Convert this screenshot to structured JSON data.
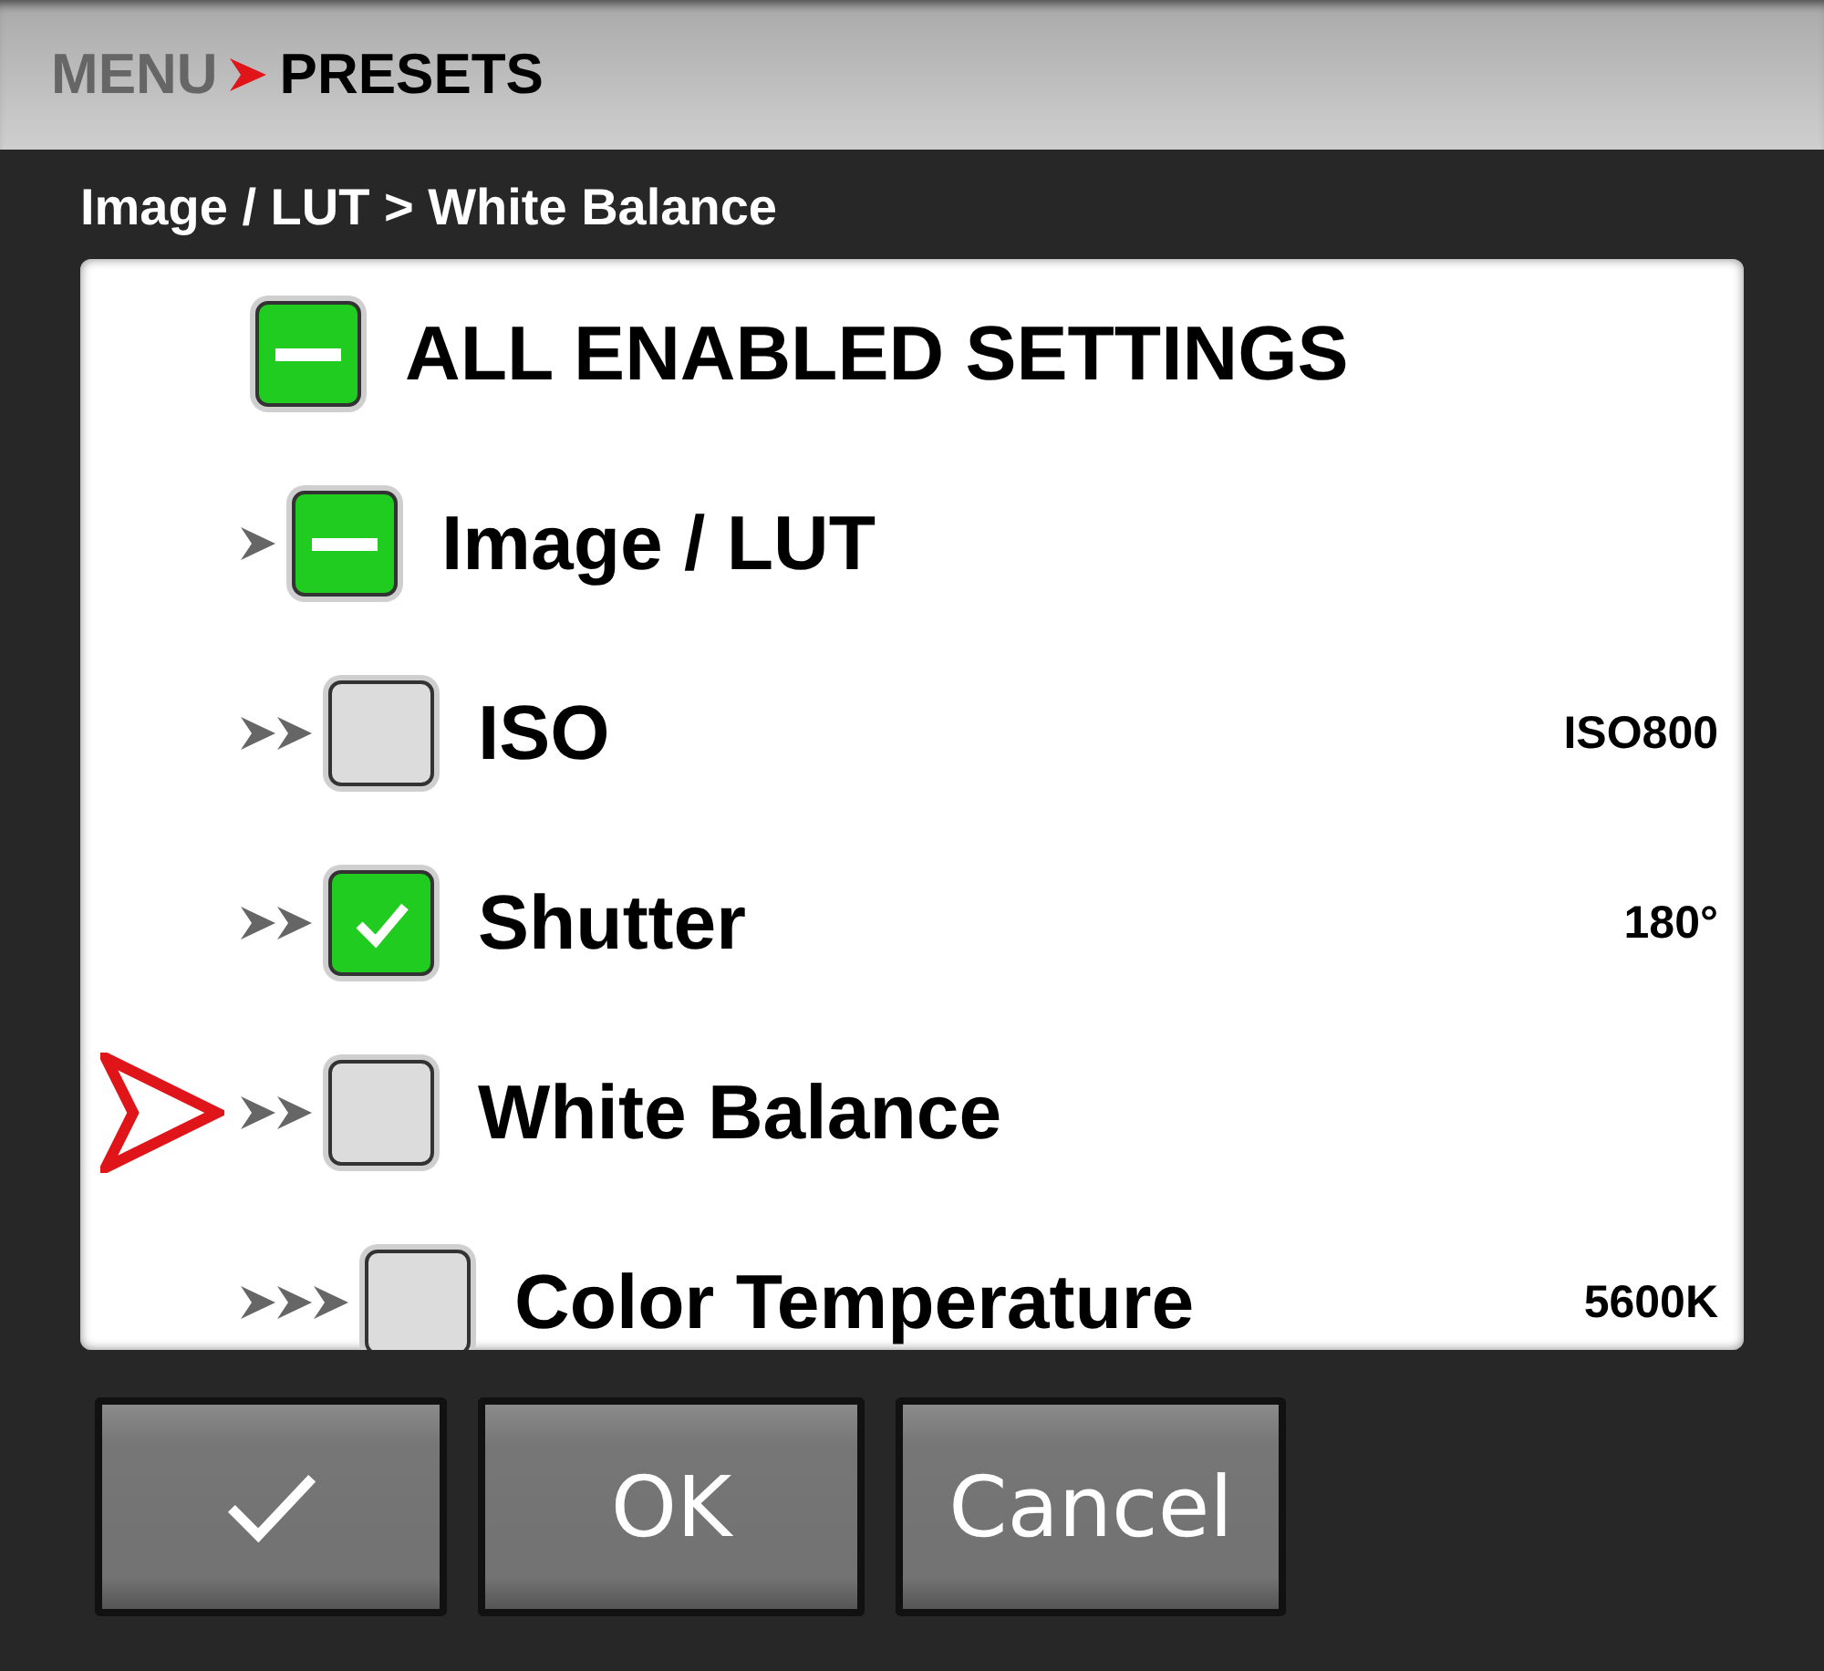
{
  "header": {
    "parent": "MENU",
    "title": "PRESETS"
  },
  "breadcrumb": "Image / LUT > White Balance",
  "tree": [
    {
      "label": "ALL ENABLED SETTINGS",
      "checked": false,
      "mixed": true,
      "selected": false,
      "children": [
        {
          "label": "Image / LUT",
          "checked": false,
          "mixed": true,
          "selected": false,
          "children": [
            {
              "label": "ISO",
              "value": "ISO800",
              "checked": false,
              "mixed": false,
              "selected": false
            },
            {
              "label": "Shutter",
              "value": "180°",
              "checked": true,
              "mixed": false,
              "selected": false
            },
            {
              "label": "White Balance",
              "checked": false,
              "mixed": false,
              "selected": true,
              "children": [
                {
                  "label": "Color Temperature",
                  "value": "5600K",
                  "checked": false,
                  "mixed": false,
                  "selected": false
                }
              ]
            }
          ]
        }
      ]
    }
  ],
  "buttons": [
    {
      "kind": "check"
    },
    {
      "kind": "text",
      "label": "OK"
    },
    {
      "kind": "text",
      "label": "Cancel"
    }
  ]
}
